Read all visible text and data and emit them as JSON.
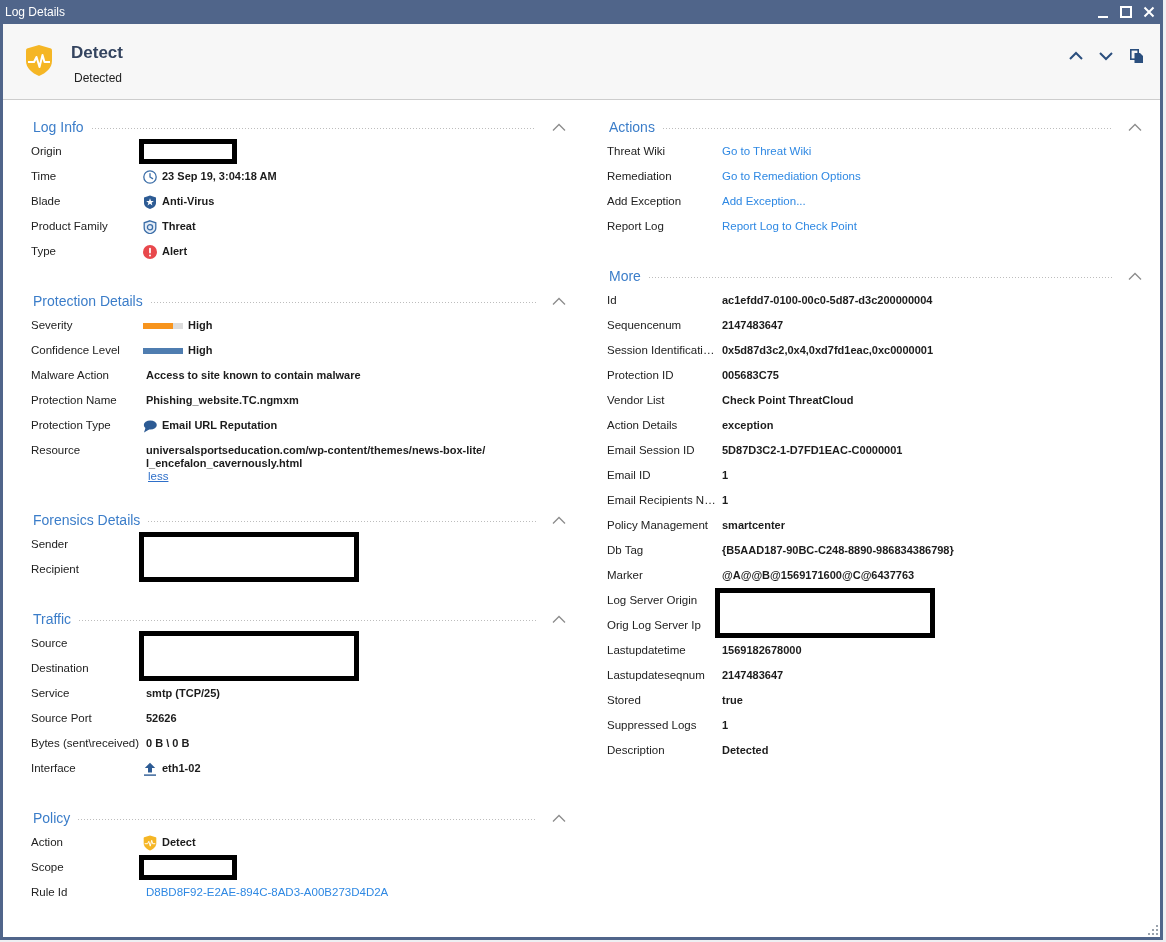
{
  "window": {
    "title": "Log Details"
  },
  "header": {
    "title": "Detect",
    "subtitle": "Detected"
  },
  "columns": [
    {
      "sections": [
        {
          "title": "Log Info",
          "expanded": true,
          "rows": [
            {
              "label": "Origin",
              "kind": "redacted"
            },
            {
              "label": "Time",
              "kind": "clock",
              "value": "23 Sep 19, 3:04:18 AM"
            },
            {
              "label": "Blade",
              "kind": "badge",
              "value": "Anti-Virus"
            },
            {
              "label": "Product Family",
              "kind": "shield",
              "value": "Threat"
            },
            {
              "label": "Type",
              "kind": "alert",
              "value": "Alert"
            }
          ]
        },
        {
          "title": "Protection Details",
          "expanded": true,
          "rows": [
            {
              "label": "Severity",
              "kind": "meter",
              "level": 0.75,
              "color": "#f7941d",
              "value": "High"
            },
            {
              "label": "Confidence Level",
              "kind": "meter",
              "level": 1,
              "color": "#4f7db0",
              "value": "High"
            },
            {
              "label": "Malware Action",
              "kind": "text",
              "value": "Access to site known to contain malware"
            },
            {
              "label": "Protection Name",
              "kind": "text",
              "value": "Phishing_website.TC.ngmxm"
            },
            {
              "label": "Protection Type",
              "kind": "bubble",
              "value": "Email URL Reputation"
            },
            {
              "label": "Resource",
              "kind": "wrap",
              "lines": [
                "universalsportseducation.com/wp-content/themes/news-box-lite/",
                "l_encefalon_cavernously.html"
              ],
              "toggle": "less"
            }
          ]
        },
        {
          "title": "Forensics Details",
          "expanded": true,
          "rows": [
            {
              "label": "Sender",
              "kind": "redacted"
            },
            {
              "label": "Recipient",
              "kind": "redacted"
            }
          ]
        },
        {
          "title": "Traffic",
          "expanded": true,
          "rows": [
            {
              "label": "Source",
              "kind": "redacted"
            },
            {
              "label": "Destination",
              "kind": "redacted"
            },
            {
              "label": "Service",
              "kind": "text",
              "value": "smtp (TCP/25)"
            },
            {
              "label": "Source Port",
              "kind": "text",
              "value": "52626"
            },
            {
              "label": "Bytes (sent\\received)",
              "kind": "text",
              "value": "0 B \\ 0 B"
            },
            {
              "label": "Interface",
              "kind": "arrow",
              "value": "eth1-02"
            }
          ]
        },
        {
          "title": "Policy",
          "expanded": true,
          "rows": [
            {
              "label": "Action",
              "kind": "detect",
              "value": "Detect"
            },
            {
              "label": "Scope",
              "kind": "redacted"
            },
            {
              "label": "Rule Id",
              "kind": "link",
              "value": "D8BD8F92-E2AE-894C-8AD3-A00B273D4D2A"
            }
          ]
        }
      ]
    },
    {
      "sections": [
        {
          "title": "Actions",
          "expanded": true,
          "rows": [
            {
              "label": "Threat Wiki",
              "kind": "link",
              "value": "Go to Threat Wiki"
            },
            {
              "label": "Remediation",
              "kind": "link",
              "value": "Go to Remediation Options"
            },
            {
              "label": "Add Exception",
              "kind": "link",
              "value": "Add Exception..."
            },
            {
              "label": "Report Log",
              "kind": "link",
              "value": "Report Log to Check Point"
            }
          ]
        },
        {
          "title": "More",
          "expanded": true,
          "rows": [
            {
              "label": "Id",
              "kind": "text",
              "value": "ac1efdd7-0100-00c0-5d87-d3c200000004"
            },
            {
              "label": "Sequencenum",
              "kind": "text",
              "value": "2147483647"
            },
            {
              "label": "Session Identificati…",
              "kind": "text",
              "value": "0x5d87d3c2,0x4,0xd7fd1eac,0xc0000001"
            },
            {
              "label": "Protection ID",
              "kind": "text",
              "value": "005683C75"
            },
            {
              "label": "Vendor List",
              "kind": "text",
              "value": "Check Point ThreatCloud"
            },
            {
              "label": "Action Details",
              "kind": "text",
              "value": "exception"
            },
            {
              "label": "Email Session ID",
              "kind": "text",
              "value": "5D87D3C2-1-D7FD1EAC-C0000001"
            },
            {
              "label": "Email ID",
              "kind": "text",
              "value": "1"
            },
            {
              "label": "Email Recipients N…",
              "kind": "text",
              "value": "1"
            },
            {
              "label": "Policy Management",
              "kind": "text",
              "value": "smartcenter"
            },
            {
              "label": "Db Tag",
              "kind": "text",
              "value": "{B5AAD187-90BC-C248-8890-986834386798}"
            },
            {
              "label": "Marker",
              "kind": "text",
              "value": "@A@@B@1569171600@C@6437763"
            },
            {
              "label": "Log Server Origin",
              "kind": "redacted"
            },
            {
              "label": "Orig Log Server Ip",
              "kind": "redacted"
            },
            {
              "label": "Lastupdatetime",
              "kind": "text",
              "value": "1569182678000"
            },
            {
              "label": "Lastupdateseqnum",
              "kind": "text",
              "value": "2147483647"
            },
            {
              "label": "Stored",
              "kind": "text",
              "value": "true"
            },
            {
              "label": "Suppressed Logs",
              "kind": "text",
              "value": "1"
            },
            {
              "label": "Description",
              "kind": "text",
              "value": "Detected"
            }
          ]
        }
      ]
    }
  ]
}
